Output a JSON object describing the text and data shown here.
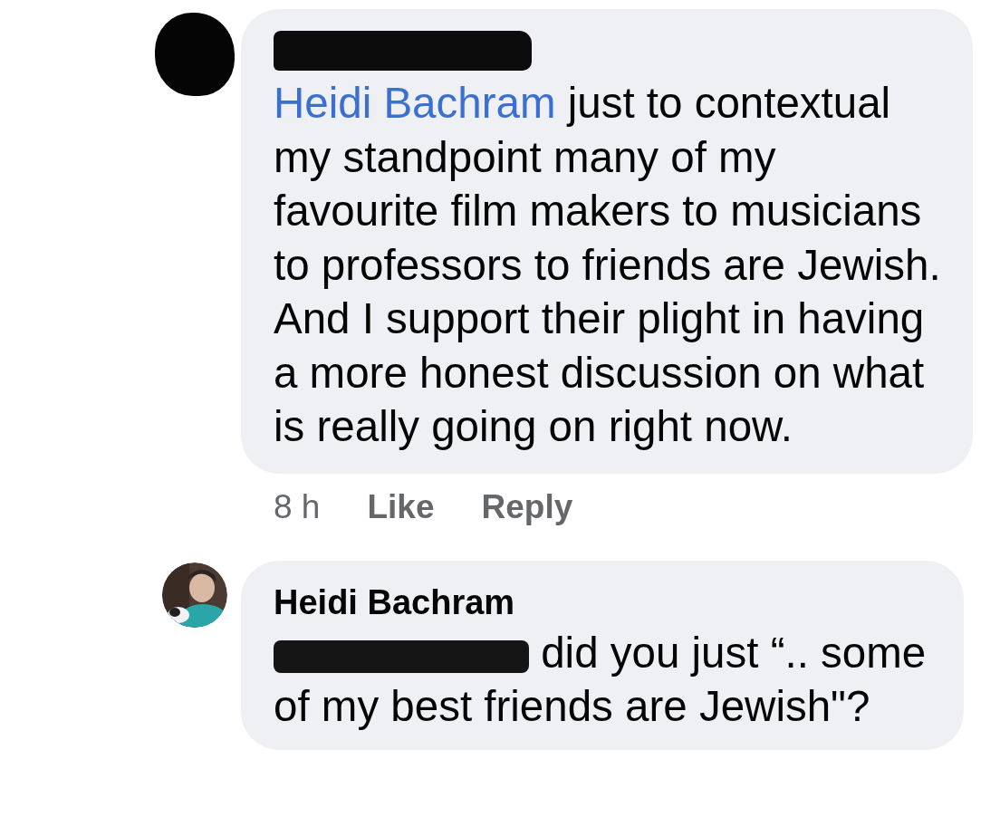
{
  "comments": [
    {
      "avatar": {
        "kind": "redacted"
      },
      "author_redacted": true,
      "mention": "Heidi Bachram",
      "mention_redacted": false,
      "body": " just to contextual my standpoint many of my favourite film makers to musicians to professors to friends are Jewish. And I support their plight in having a more honest discussion on what is really going on right now.",
      "time": "8 h",
      "actions": [
        "Like",
        "Reply"
      ]
    },
    {
      "author_redacted": false,
      "author": "Heidi Bachram",
      "mention_redacted": true,
      "body": " did you just “.. some of my best friends are Jewish\"?"
    }
  ]
}
